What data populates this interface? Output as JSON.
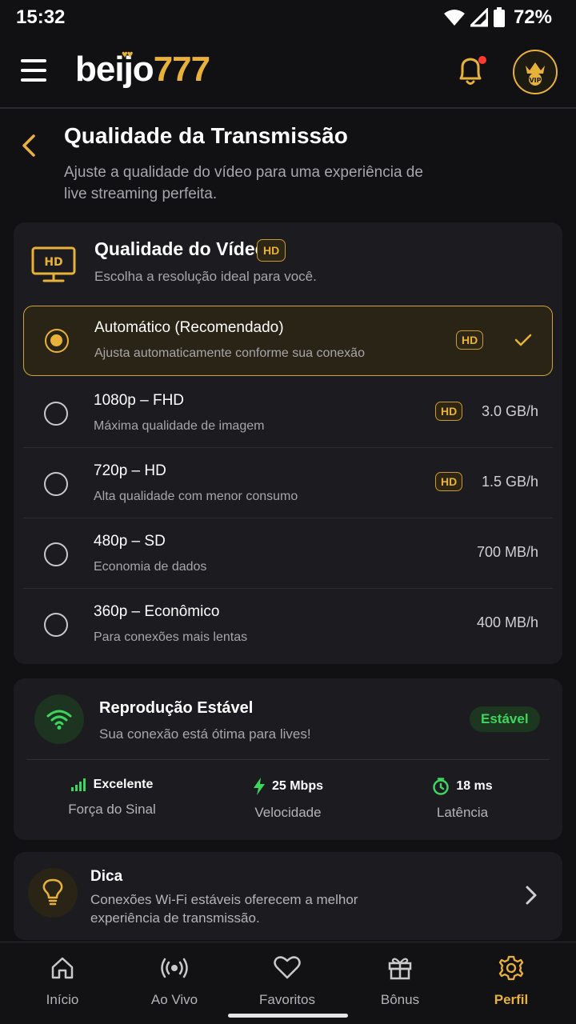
{
  "status_bar": {
    "time": "15:32",
    "battery": "72%"
  },
  "header": {
    "logo_main": "beijo",
    "logo_num": "777"
  },
  "page": {
    "title": "Qualidade da Transmissão",
    "subtitle": "Ajuste a qualidade do vídeo para uma experiência de live streaming perfeita."
  },
  "video_quality": {
    "title": "Qualidade do Vídeo",
    "badge": "HD",
    "subtitle": "Escolha a resolução ideal para você.",
    "options": [
      {
        "title": "Automático (Recomendado)",
        "subtitle": "Ajusta automaticamente conforme sua conexão",
        "hd": "HD",
        "size": "",
        "selected": true
      },
      {
        "title": "1080p – FHD",
        "subtitle": "Máxima qualidade de imagem",
        "hd": "HD",
        "size": "3.0 GB/h",
        "selected": false
      },
      {
        "title": "720p – HD",
        "subtitle": "Alta qualidade com menor consumo",
        "hd": "HD",
        "size": "1.5 GB/h",
        "selected": false
      },
      {
        "title": "480p – SD",
        "subtitle": "Economia de dados",
        "hd": "",
        "size": "700 MB/h",
        "selected": false
      },
      {
        "title": "360p – Econômico",
        "subtitle": "Para conexões mais lentas",
        "hd": "",
        "size": "400 MB/h",
        "selected": false
      }
    ]
  },
  "stability": {
    "title": "Reprodução Estável",
    "subtitle": "Sua conexão está ótima para lives!",
    "badge": "Estável",
    "metrics": [
      {
        "value": "Excelente",
        "label": "Força do Sinal",
        "icon": "signal-bars-icon"
      },
      {
        "value": "25 Mbps",
        "label": "Velocidade",
        "icon": "bolt-icon"
      },
      {
        "value": "18 ms",
        "label": "Latência",
        "icon": "timer-icon"
      }
    ]
  },
  "tip": {
    "title": "Dica",
    "text": "Conexões Wi-Fi estáveis oferecem a melhor experiência de transmissão."
  },
  "nav": {
    "items": [
      {
        "label": "Início",
        "icon": "home-icon"
      },
      {
        "label": "Ao Vivo",
        "icon": "broadcast-icon"
      },
      {
        "label": "Favoritos",
        "icon": "heart-icon"
      },
      {
        "label": "Bônus",
        "icon": "gift-icon"
      },
      {
        "label": "Perfil",
        "icon": "gear-icon"
      }
    ],
    "active": "Perfil"
  },
  "colors": {
    "accent": "#e8b23a",
    "success": "#3ed55e",
    "background": "#111114",
    "card": "#1c1c20"
  }
}
